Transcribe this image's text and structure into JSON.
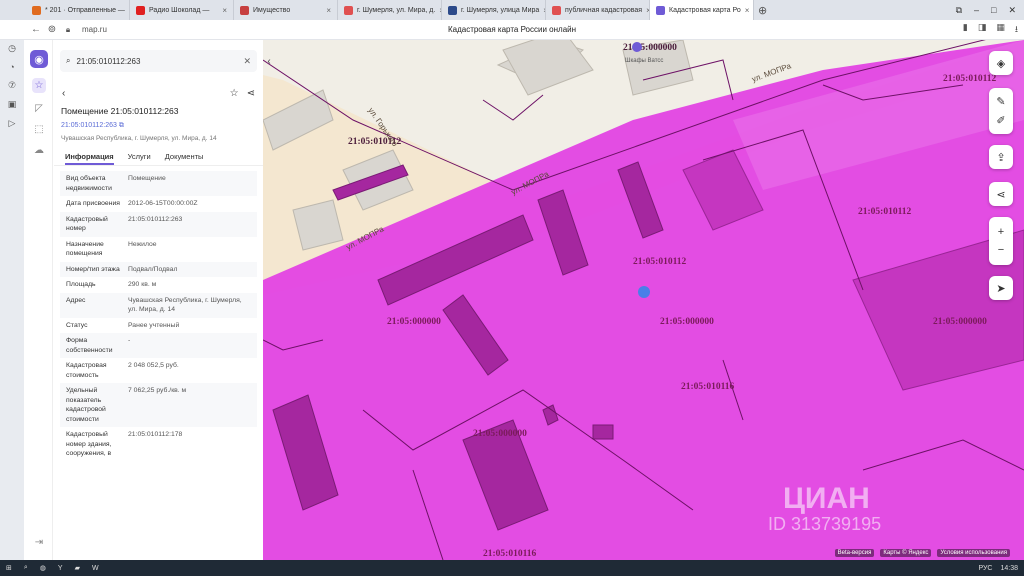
{
  "browser": {
    "tabs": [
      {
        "label": "* 201 · Отправленные — ",
        "color": "#e06b1f",
        "active": false
      },
      {
        "label": "Радио Шоколад — ",
        "color": "#e02020",
        "active": false
      },
      {
        "label": "Имущество",
        "color": "#c74040",
        "active": false
      },
      {
        "label": "г. Шумерля, ул. Мира, д.",
        "color": "#e05050",
        "active": false
      },
      {
        "label": "г. Шумерля, улица Мира",
        "color": "#2c4a8a",
        "active": false
      },
      {
        "label": "публичная кадастровая",
        "color": "#e05050",
        "active": false
      },
      {
        "label": "Кадастровая карта Ро",
        "color": "#6f5bd6",
        "active": true
      }
    ],
    "url": "map.ru",
    "page_title": "Кадастровая карта России онлайн"
  },
  "search": {
    "value": "21:05:010112:263"
  },
  "property": {
    "title": "Помещение 21:05:010112:263",
    "cadastral_link": "21:05:010112:263",
    "address_sub": "Чувашская Республика, г. Шумерля, ул. Мира, д. 14",
    "tabs": [
      "Информация",
      "Услуги",
      "Документы"
    ],
    "rows": [
      {
        "k": "Вид объекта недвижимости",
        "v": "Помещение"
      },
      {
        "k": "Дата присвоения",
        "v": "2012-06-15T00:00:00Z"
      },
      {
        "k": "Кадастровый номер",
        "v": "21:05:010112:263"
      },
      {
        "k": "Назначение помещения",
        "v": "Нежилое"
      },
      {
        "k": "Номер/тип этажа",
        "v": "Подвал/Подвал"
      },
      {
        "k": "Площадь",
        "v": "290 кв. м"
      },
      {
        "k": "Адрес",
        "v": "Чувашская Республика, г. Шумерля, ул. Мира, д. 14"
      },
      {
        "k": "Статус",
        "v": "Ранее учтенный"
      },
      {
        "k": "Форма собственности",
        "v": "-"
      },
      {
        "k": "Кадастровая стоимость",
        "v": "2 048 052,5 руб."
      },
      {
        "k": "Удельный показатель кадастровой стоимости",
        "v": "7 062,25 руб./кв. м"
      },
      {
        "k": "Кадастровый номер здания, сооружения, в",
        "v": "21:05:010112:178"
      }
    ]
  },
  "map": {
    "parcel_color": "#e040e0",
    "labels": [
      "21:05:000000",
      "21:05:010112",
      "21:05:010112",
      "21:05:010112",
      "21:05:000000",
      "21:05:000000",
      "21:05:000000",
      "21:05:010116",
      "21:05:010112",
      "21:05:010116",
      "21:05:000000"
    ],
    "streets": [
      "ул. МОПРа",
      "ул. МОПРа",
      "ул. МОПРа",
      "ул. Горького"
    ],
    "poi": "Шкафы Ватсс",
    "watermark": "ЦИАН",
    "watermark_id": "ID 313739195",
    "footer": [
      "Beta-версия",
      "Карты © Яндекс",
      "Условия использования"
    ]
  },
  "taskbar": {
    "lang": "РУС",
    "time": "14:38"
  }
}
